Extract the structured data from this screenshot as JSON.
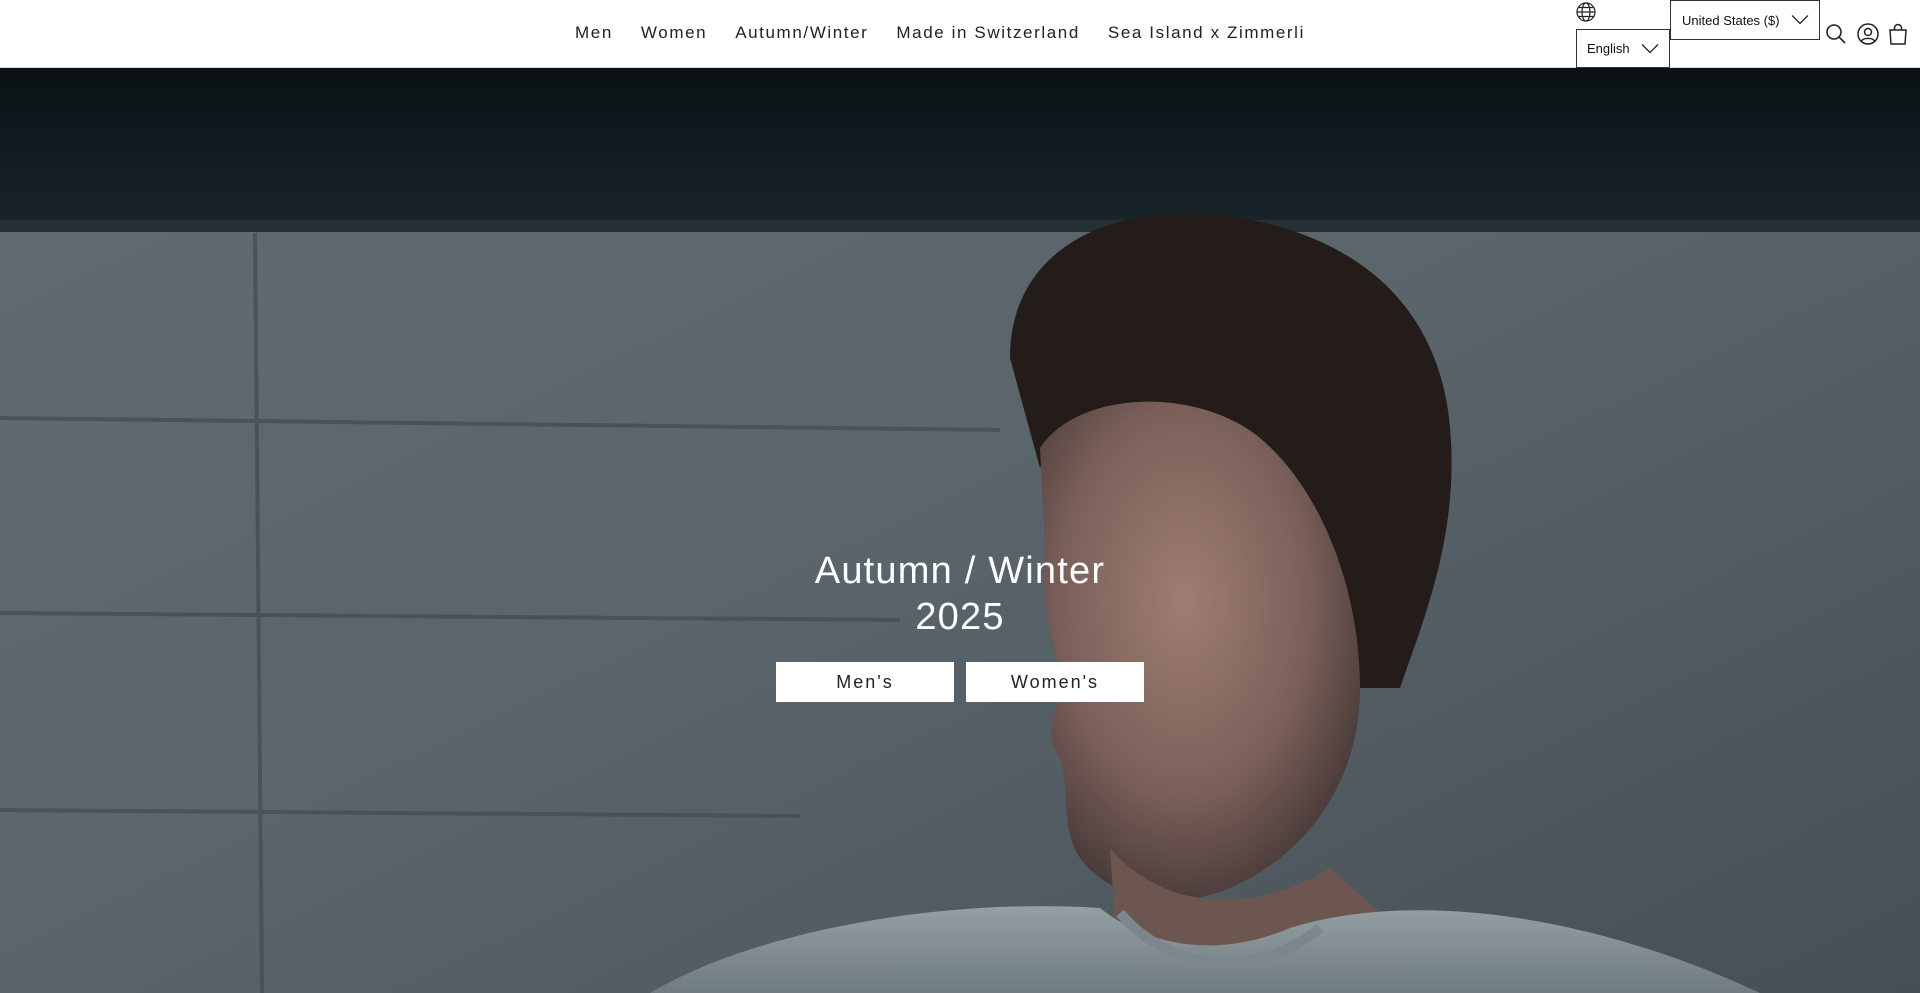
{
  "nav": {
    "items": [
      {
        "label": "Men"
      },
      {
        "label": "Women"
      },
      {
        "label": "Autumn/Winter"
      },
      {
        "label": "Made in Switzerland"
      },
      {
        "label": "Sea Island x Zimmerli"
      }
    ]
  },
  "locale": {
    "country": "United States ($)",
    "language": "English"
  },
  "icons": {
    "globe": "globe-icon",
    "search": "search-icon",
    "account": "account-icon",
    "cart": "cart-icon",
    "chevron": "chevron-down-icon"
  },
  "hero": {
    "title": "Autumn / Winter 2025",
    "buttons": [
      {
        "label": "Men's"
      },
      {
        "label": "Women's"
      }
    ]
  },
  "colors": {
    "header_bg": "#ffffff",
    "button_bg": "#ffffff",
    "hero_text": "#ffffff"
  }
}
